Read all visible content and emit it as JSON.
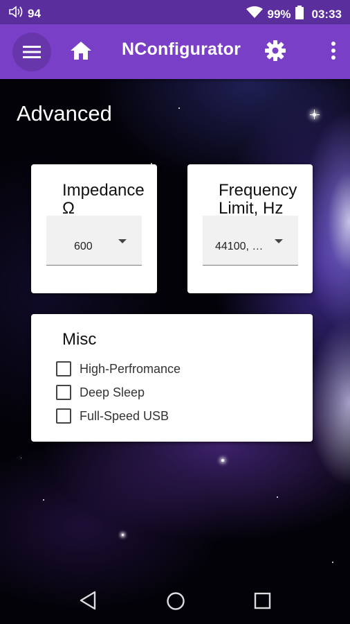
{
  "status_bar": {
    "volume_icon": "volume-icon",
    "volume_level": "94",
    "wifi_icon": "wifi-icon",
    "battery_percent": "99%",
    "battery_icon": "battery-icon",
    "time": "03:33"
  },
  "app_bar": {
    "title": "NConfigurator",
    "menu_icon": "hamburger-menu-icon",
    "home_icon": "home-icon",
    "settings_icon": "gear-icon",
    "overflow_icon": "more-vertical-icon",
    "color": "#7a3fc7",
    "status_color": "#5b2e9e"
  },
  "page": {
    "heading": "Advanced"
  },
  "impedance": {
    "title": "Impedance Ω",
    "selected": "600"
  },
  "frequency": {
    "title": "Frequency Limit, Hz",
    "selected": "44100, …"
  },
  "misc": {
    "title": "Misc",
    "options": [
      {
        "label": "High-Perfromance",
        "checked": false
      },
      {
        "label": "Deep Sleep",
        "checked": false
      },
      {
        "label": "Full-Speed USB",
        "checked": false
      }
    ]
  },
  "nav_bar": {
    "back_icon": "back-triangle-icon",
    "home_icon": "home-circle-icon",
    "recents_icon": "recents-square-icon"
  }
}
